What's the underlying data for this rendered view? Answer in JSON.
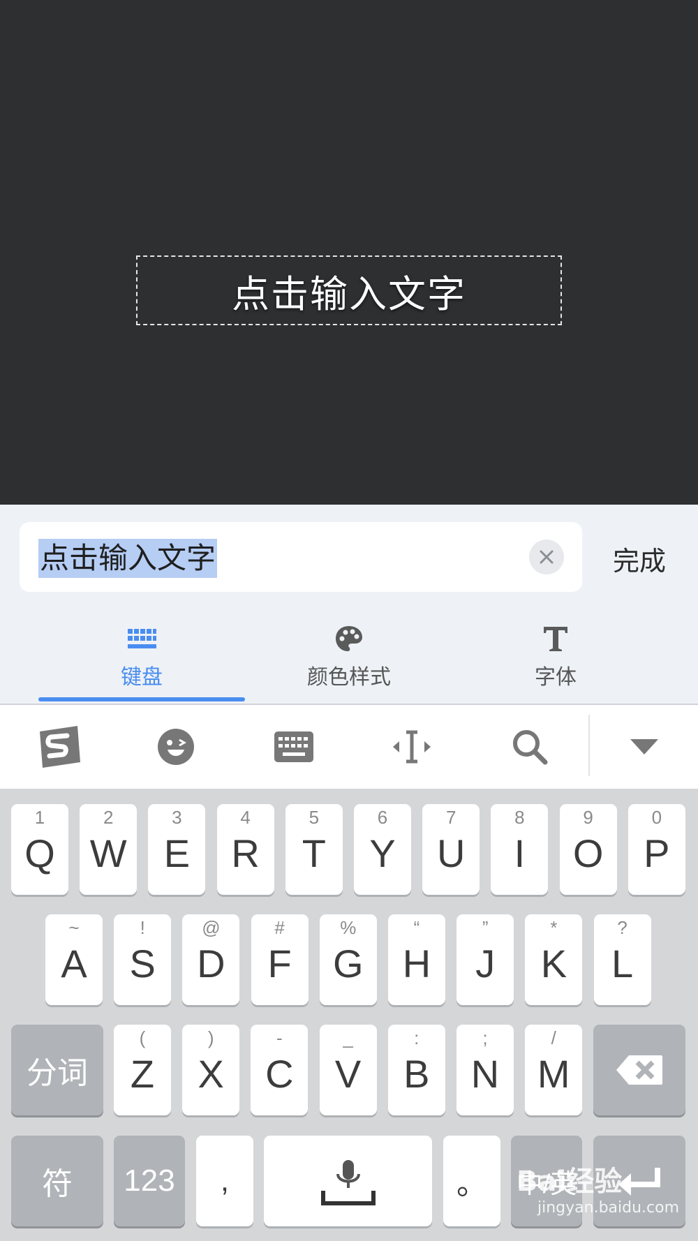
{
  "canvas": {
    "placeholder_text": "点击输入文字"
  },
  "editor": {
    "input_value": "点击输入文字",
    "done_label": "完成",
    "tabs": [
      {
        "label": "键盘",
        "icon": "keyboard-grid-icon",
        "active": true
      },
      {
        "label": "颜色样式",
        "icon": "palette-icon",
        "active": false
      },
      {
        "label": "字体",
        "icon": "font-T-icon",
        "active": false
      }
    ],
    "colors": {
      "accent": "#4a8df0",
      "tab_inactive": "#555555",
      "selection": "#b6cdf4"
    }
  },
  "ime_toolbar": {
    "icons": [
      "sogou-logo-icon",
      "emoji-icon",
      "keyboard-icon",
      "cursor-move-icon",
      "search-icon",
      "collapse-arrow-icon"
    ]
  },
  "keyboard": {
    "row1": [
      {
        "letter": "Q",
        "alt": "1"
      },
      {
        "letter": "W",
        "alt": "2"
      },
      {
        "letter": "E",
        "alt": "3"
      },
      {
        "letter": "R",
        "alt": "4"
      },
      {
        "letter": "T",
        "alt": "5"
      },
      {
        "letter": "Y",
        "alt": "6"
      },
      {
        "letter": "U",
        "alt": "7"
      },
      {
        "letter": "I",
        "alt": "8"
      },
      {
        "letter": "O",
        "alt": "9"
      },
      {
        "letter": "P",
        "alt": "0"
      }
    ],
    "row2": [
      {
        "letter": "A",
        "alt": "~"
      },
      {
        "letter": "S",
        "alt": "!"
      },
      {
        "letter": "D",
        "alt": "@"
      },
      {
        "letter": "F",
        "alt": "#"
      },
      {
        "letter": "G",
        "alt": "%"
      },
      {
        "letter": "H",
        "alt": "“"
      },
      {
        "letter": "J",
        "alt": "”"
      },
      {
        "letter": "K",
        "alt": "*"
      },
      {
        "letter": "L",
        "alt": "?"
      }
    ],
    "row3": [
      {
        "letter": "Z",
        "alt": "("
      },
      {
        "letter": "X",
        "alt": ")"
      },
      {
        "letter": "C",
        "alt": "-"
      },
      {
        "letter": "V",
        "alt": "_"
      },
      {
        "letter": "B",
        "alt": ":"
      },
      {
        "letter": "N",
        "alt": ";"
      },
      {
        "letter": "M",
        "alt": "/"
      }
    ],
    "segment_label": "分词",
    "symbol_label": "符",
    "numeric_label": "123",
    "comma_label": ",",
    "period_label": "。",
    "lang_switch_label": "中/英",
    "backspace_icon": "backspace-icon",
    "mic_icon": "microphone-icon",
    "enter_icon": "enter-icon"
  },
  "watermark": {
    "brand": "Bai经验",
    "url": "jingyan.baidu.com"
  }
}
